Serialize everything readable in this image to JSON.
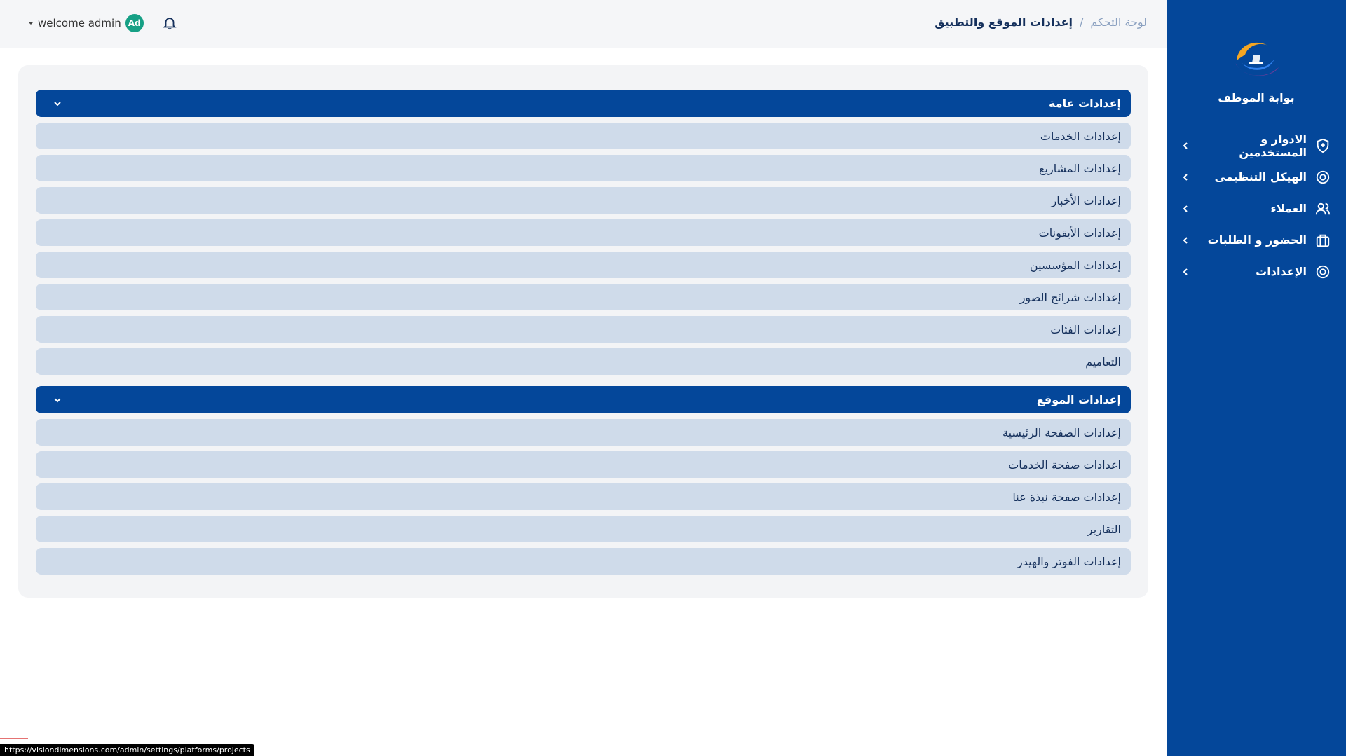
{
  "sidebar": {
    "brand": "بوابة الموظف",
    "items": [
      {
        "label": "الادوار و المستخدمين",
        "icon": "shield-icon"
      },
      {
        "label": "الهيكل التنظيمى",
        "icon": "target-icon"
      },
      {
        "label": "العملاء",
        "icon": "users-icon"
      },
      {
        "label": "الحضور و الطلبات",
        "icon": "briefcase-icon"
      },
      {
        "label": "الإعدادات",
        "icon": "settings-icon"
      }
    ]
  },
  "header": {
    "breadcrumb_root": "لوحة التحكم",
    "breadcrumb_sep": "/",
    "breadcrumb_current": "إعدادات الموقع والتطبيق",
    "welcome": "welcome admin",
    "avatar_initials": "Ad"
  },
  "groups": [
    {
      "title": "إعدادات عامة",
      "items": [
        "إعدادات الخدمات",
        "إعدادات المشاريع",
        "إعدادات الأخبار",
        "إعدادات الأيقونات",
        "إعدادات المؤسسين",
        "إعدادات شرائح الصور",
        "إعدادات الفئات",
        "التعاميم"
      ]
    },
    {
      "title": "إعدادات الموقع",
      "items": [
        "إعدادات الصفحة الرئيسية",
        "اعدادات صفحة الخدمات",
        "إعدادات صفحة نبذة عنا",
        "التقارير",
        "إعدادات الفوتر والهيدر"
      ]
    }
  ],
  "status_bar": {
    "url": "https://visiondimensions.com/admin/settings/platforms/projects"
  },
  "colors": {
    "primary": "#04479a",
    "item_bg": "#cfdbea",
    "panel_bg": "#f3f4f6",
    "avatar_bg": "#16a085"
  }
}
